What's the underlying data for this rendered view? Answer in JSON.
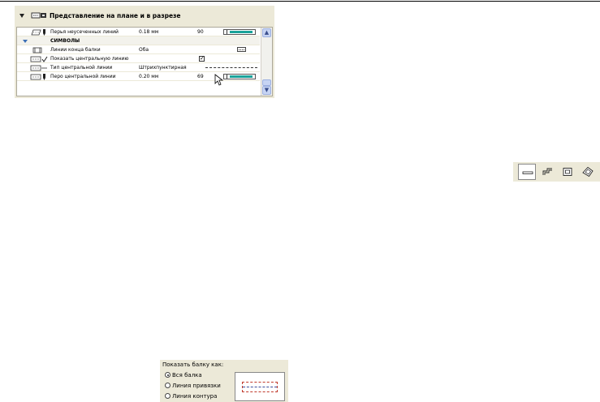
{
  "panel": {
    "header_title": "Представление на плане и в разрезе",
    "rows": [
      {
        "icon": "pen-icon",
        "label": "Перья неусеченных линий",
        "value": "0.18 мм",
        "pen_number": "90",
        "color": "#1aa39a"
      },
      {
        "label": "СИМВОЛЫ"
      },
      {
        "icon": "beam-end-icon",
        "label": "Линии конца балки",
        "value": "Оба"
      },
      {
        "icon": "centerline-icon",
        "label": "Показать центральную линию",
        "checked": true
      },
      {
        "icon": "linetype-icon",
        "label": "Тип центральной линии",
        "value": "Штрихпунктирная"
      },
      {
        "icon": "pen-icon",
        "label": "Перо центральной линии",
        "value": "0.20 мм",
        "pen_number": "69",
        "color": "#1aa39a"
      }
    ],
    "checkbox_mark": "✓",
    "scroll_up": "▲",
    "scroll_down": "▼"
  },
  "toolbar": {
    "buttons": [
      {
        "name": "straight-beam-icon",
        "active": true
      },
      {
        "name": "stepped-beam-icon",
        "active": false
      },
      {
        "name": "rect-profile-icon",
        "active": false
      },
      {
        "name": "rotated-profile-icon",
        "active": false
      }
    ]
  },
  "display": {
    "title": "Показать балку как:",
    "options": [
      {
        "label": "Вся балка",
        "selected": true
      },
      {
        "label": "Линия привязки",
        "selected": false
      },
      {
        "label": "Линия контура",
        "selected": false
      }
    ]
  }
}
